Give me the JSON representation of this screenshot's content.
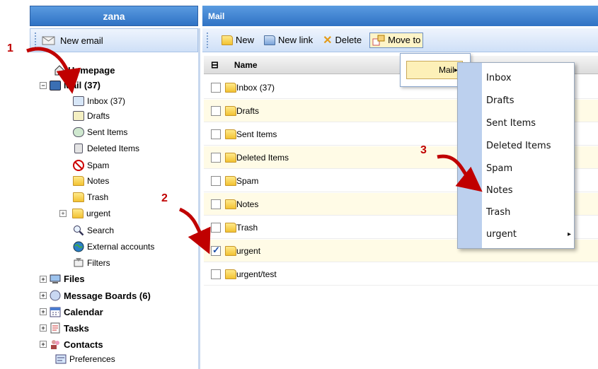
{
  "left": {
    "header_title": "zana",
    "new_email_label": "New email",
    "tree": {
      "homepage": "Homepage",
      "mail": "Mail (37)",
      "inbox": "Inbox (37)",
      "drafts": "Drafts",
      "sent": "Sent Items",
      "deleted": "Deleted Items",
      "spam": "Spam",
      "notes": "Notes",
      "trash": "Trash",
      "urgent": "urgent",
      "search": "Search",
      "external": "External accounts",
      "filters": "Filters",
      "files": "Files",
      "boards": "Message Boards (6)",
      "calendar": "Calendar",
      "tasks": "Tasks",
      "contacts": "Contacts",
      "preferences": "Preferences"
    }
  },
  "right": {
    "header_title": "Mail",
    "toolbar": {
      "new": "New",
      "new_link": "New link",
      "delete": "Delete",
      "move_to": "Move to"
    },
    "list_header": {
      "name": "Name",
      "select_icon": "⊟"
    },
    "rows": [
      {
        "name": "Inbox (37)",
        "checked": false
      },
      {
        "name": "Drafts",
        "checked": false
      },
      {
        "name": "Sent Items",
        "checked": false
      },
      {
        "name": "Deleted Items",
        "checked": false
      },
      {
        "name": "Spam",
        "checked": false
      },
      {
        "name": "Notes",
        "checked": false
      },
      {
        "name": "Trash",
        "checked": false
      },
      {
        "name": "urgent",
        "checked": true
      },
      {
        "name": "urgent/test",
        "checked": false
      }
    ]
  },
  "menu": {
    "mail_label": "Mail",
    "mail_arrow": "▸",
    "submenu": [
      "Inbox",
      "Drafts",
      "Sent Items",
      "Deleted Items",
      "Spam",
      "Notes",
      "Trash",
      "urgent"
    ],
    "submenu_arrow": "▸"
  },
  "callouts": {
    "one": "1",
    "two": "2",
    "three": "3"
  },
  "colors": {
    "header_blue": "#2f72c4",
    "callout_red": "#c00000",
    "row_alt": "#fffbe6"
  }
}
